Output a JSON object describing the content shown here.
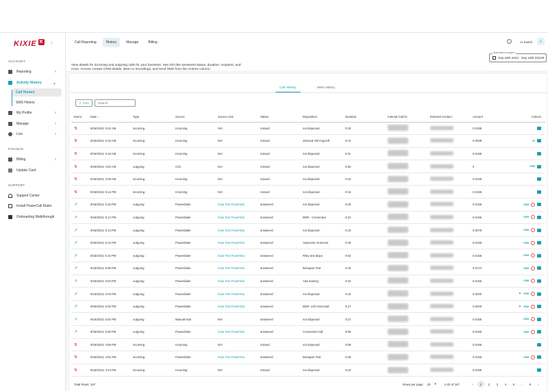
{
  "app": {
    "logo_text": "KIXIE",
    "logo_badge": "K",
    "collapse": "‹"
  },
  "sidebar": {
    "sections": [
      "ACCOUNT",
      "FINANCE",
      "SUPPORT"
    ],
    "items": [
      {
        "label": "Reporting",
        "icon": "chart-icon"
      },
      {
        "label": "Activity History",
        "icon": "history-icon"
      },
      {
        "label": "Call History"
      },
      {
        "label": "SMS History"
      },
      {
        "label": "My Profile",
        "icon": "profile-icon"
      },
      {
        "label": "Manage",
        "icon": "manage-icon"
      },
      {
        "label": "Live",
        "icon": "live-icon"
      },
      {
        "label": "Billing",
        "icon": "billing-icon"
      },
      {
        "label": "Update Card"
      },
      {
        "label": "Support Center",
        "icon": "headset-icon"
      },
      {
        "label": "Install PowerCall Dialer",
        "icon": "download-icon"
      },
      {
        "label": "Onboarding Walkthrough",
        "icon": "walkthrough-icon"
      }
    ]
  },
  "header": {
    "tabs": [
      "Call Reporting",
      "History",
      "Manage",
      "Billing"
    ],
    "active_tab": "History",
    "help": "?",
    "user_name": "cs maeni",
    "avatar": "C"
  },
  "description": "View details for incoming and outgoing calls for your business. See info like answered status, duration, recipient, and more. Access contact CRM details, listen to recordings, and send SMS from the Actions column.",
  "date_filter": {
    "label": "Americas/Los Angeles",
    "value": "Sep 18th 2023 - Sep 18th 2023"
  },
  "inner_tabs": [
    "Call History",
    "SMS History"
  ],
  "toolbar": {
    "csv_label": "CSV",
    "search_placeholder": "Search"
  },
  "table": {
    "columns": [
      "Event",
      "Date",
      "Type",
      "Source",
      "Source Link",
      "Status",
      "Disposition",
      "Duration",
      "Internal Call ID",
      "External Contact",
      "Amount",
      "Actions"
    ],
    "rows": [
      {
        "ev": "missed",
        "date": "9/18/2023, 6:22 AM",
        "type": "incoming",
        "source": "Incoming",
        "link": "N/A",
        "status": "missed",
        "disp": "not disposed",
        "dur": "0:30",
        "amt": "0.0195",
        "act": [
          "msg"
        ]
      },
      {
        "ev": "missed",
        "date": "9/18/2023, 6:19 AM",
        "type": "incoming",
        "source": "Incoming",
        "link": "N/A",
        "status": "missed",
        "disp": "inbound VM msg left",
        "dur": "0:41",
        "amt": "0.0039",
        "act": [
          "link",
          "msg"
        ]
      },
      {
        "ev": "missed",
        "date": "9/18/2023, 6:18 AM",
        "type": "incoming",
        "source": "Incoming",
        "link": "N/A",
        "status": "missed",
        "disp": "not disposed",
        "dur": "0:11",
        "amt": "0.0195",
        "act": [
          "msg"
        ]
      },
      {
        "ev": "missed",
        "date": "9/18/2023, 3:50 AM",
        "type": "outgoing",
        "source": "C2C",
        "link": "N/A",
        "status": "missed",
        "disp": "not disposed",
        "dur": "0:52",
        "amt": "0",
        "act": [
          "crm",
          "msg"
        ]
      },
      {
        "ev": "missed",
        "date": "9/18/2023, 3:39 AM",
        "type": "incoming",
        "source": "Incoming",
        "link": "N/A",
        "status": "missed",
        "disp": "not disposed",
        "dur": "0:22",
        "amt": "0.0165",
        "act": [
          "msg"
        ]
      },
      {
        "ev": "missed",
        "date": "9/18/2023, 5:14 PM",
        "type": "incoming",
        "source": "Incoming",
        "link": "N/A",
        "status": "missed",
        "disp": "not disposed",
        "dur": "0:15",
        "amt": "0.0195",
        "act": [
          "msg"
        ]
      },
      {
        "ev": "out",
        "date": "9/18/2023, 5:15 PM",
        "type": "outgoing",
        "source": "Powerdialer",
        "link": "Kixie Test Powerlist1",
        "status": "answered",
        "disp": "not disposed",
        "dur": "0:29",
        "amt": "0.0156",
        "act": [
          "crm",
          "rec",
          "msg"
        ]
      },
      {
        "ev": "out",
        "date": "9/18/2023, 5:14 PM",
        "type": "outgoing",
        "source": "Powerdialer",
        "link": "Kixie Test Powerlist1",
        "status": "answered",
        "disp": "BDR - Connected",
        "dur": "0:31",
        "amt": "0.0156",
        "act": [
          "crm",
          "rec",
          "msg"
        ]
      },
      {
        "ev": "out",
        "date": "9/18/2023, 5:13 PM",
        "type": "outgoing",
        "source": "Powerdialer",
        "link": "Kixie Test Powerlist1",
        "status": "answered",
        "disp": "not disposed",
        "dur": "0:10",
        "amt": "0.0078",
        "act": [
          "crm",
          "rec",
          "msg"
        ]
      },
      {
        "ev": "out",
        "date": "9/18/2023, 5:12 PM",
        "type": "outgoing",
        "source": "Powerdialer",
        "link": "Kixie Test Powerlist1",
        "status": "answered",
        "disp": "Awesome Outcome",
        "dur": "0:29",
        "amt": "0.0156",
        "act": [
          "crm",
          "rec",
          "msg"
        ]
      },
      {
        "ev": "out",
        "date": "9/18/2023, 5:10 PM",
        "type": "outgoing",
        "source": "Powerdialer",
        "link": "Kixie Test Powerlist1",
        "status": "answered",
        "disp": "Riley test dispo",
        "dur": "0:52",
        "amt": "0.0156",
        "act": [
          "crm",
          "rec",
          "msg"
        ]
      },
      {
        "ev": "out",
        "date": "9/18/2023, 5:06 PM",
        "type": "outgoing",
        "source": "Powerdialer",
        "link": "Kixie Test Powerlist1",
        "status": "answered",
        "disp": "Beaupan Test",
        "dur": "0:42",
        "amt": "0.0174",
        "act": [
          "crm",
          "rec",
          "msg"
        ]
      },
      {
        "ev": "out",
        "date": "9/18/2023, 5:04 PM",
        "type": "outgoing",
        "source": "Powerdialer",
        "link": "Kixie Test Powerlist1",
        "status": "answered",
        "disp": "Ada training",
        "dur": "0:34",
        "amt": "0.0156",
        "act": [
          "crm",
          "rec",
          "msg"
        ]
      },
      {
        "ev": "out",
        "date": "9/18/2023, 5:03 PM",
        "type": "outgoing",
        "source": "Powerdialer",
        "link": "Kixie Test Powerlist1",
        "status": "answered",
        "disp": "not disposed",
        "dur": "0:15",
        "amt": "0.0200",
        "act": [
          "gear",
          "crm",
          "rec",
          "msg"
        ]
      },
      {
        "ev": "out",
        "date": "9/18/2023, 5:02 PM",
        "type": "outgoing",
        "source": "Powerdialer",
        "link": "Kixie Test Powerlist1",
        "status": "answered",
        "disp": "BDR- Left Voicemail",
        "dur": "0:17",
        "amt": "0.0200",
        "act": [
          "gear",
          "crm",
          "rec",
          "msg"
        ]
      },
      {
        "ev": "out",
        "date": "9/18/2023, 5:02 PM",
        "type": "outgoing",
        "source": "Manual-Dial",
        "link": "N/A",
        "status": "answered",
        "disp": "not disposed",
        "dur": "0:27",
        "amt": "0.0156",
        "act": [
          "crm",
          "rec",
          "msg"
        ]
      },
      {
        "ev": "out",
        "date": "9/18/2023, 5:00 PM",
        "type": "outgoing",
        "source": "Powerdialer",
        "link": "Kixie Test Powerlist1",
        "status": "answered",
        "disp": "Connected Call",
        "dur": "0:59",
        "amt": "0.0156",
        "act": [
          "crm",
          "rec",
          "msg"
        ]
      },
      {
        "ev": "missed",
        "date": "9/18/2023, 4:58 PM",
        "type": "incoming",
        "source": "Incoming",
        "link": "N/A",
        "status": "missed",
        "disp": "not disposed",
        "dur": "0:09",
        "amt": "0.0195",
        "act": [
          "msg"
        ]
      },
      {
        "ev": "missed",
        "date": "9/18/2023, 4:51 PM",
        "type": "incoming",
        "source": "Powerdialer",
        "link": "Kixie Test Powerlist1",
        "status": "answered",
        "disp": "Beaupan Test",
        "dur": "0:26",
        "amt": "0.0156",
        "act": [
          "crm",
          "rec",
          "msg"
        ]
      },
      {
        "ev": "missed",
        "date": "9/18/2023, 4:44 PM",
        "type": "incoming",
        "source": "Incoming",
        "link": "N/A",
        "status": "missed",
        "disp": "not disposed",
        "dur": "0:10",
        "amt": "0.0195",
        "act": [
          "msg"
        ]
      }
    ]
  },
  "footer": {
    "total": "Total Rows: 167",
    "rows_per_page_label": "Rows per page",
    "rows_per_page": "20",
    "range": "1-20 of 167",
    "pages": [
      "‹",
      "1",
      "2",
      "3",
      "4",
      "5",
      "...",
      "9",
      "›"
    ]
  }
}
